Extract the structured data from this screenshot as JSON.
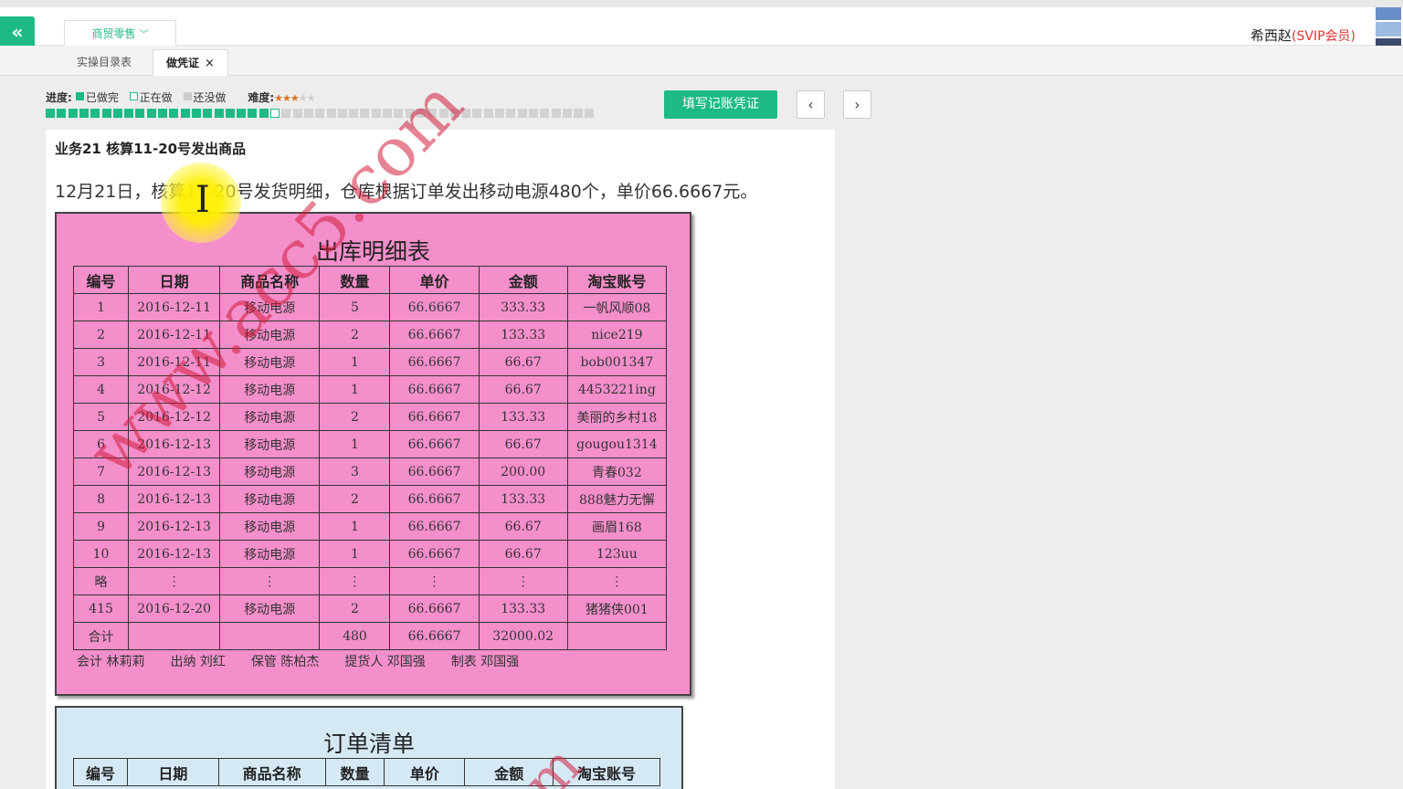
{
  "top": {
    "back_icon": "«",
    "module": "商贸零售",
    "user": "希西赵",
    "vip": "(SVIP会员)"
  },
  "tabs": [
    {
      "label": "实操目录表"
    },
    {
      "label": "做凭证",
      "close": "×"
    }
  ],
  "legend": {
    "progress_label": "进度:",
    "done": "已做完",
    "doing": "正在做",
    "todo": "还没做",
    "difficulty_label": "难度:",
    "difficulty_stars": 3,
    "difficulty_max": 5
  },
  "progress": {
    "total": 49,
    "done": 20,
    "current": 21
  },
  "buttons": {
    "fill": "填写记账凭证",
    "prev": "‹",
    "next": "›"
  },
  "task": {
    "title": "业务21 核算11-20号发出商品",
    "description": "12月21日，核算11-20号发货明细，仓库根据订单发出移动电源480个，单价66.6667元。"
  },
  "doc1": {
    "title": "出库明细表",
    "headers": [
      "编号",
      "日期",
      "商品名称",
      "数量",
      "单价",
      "金额",
      "淘宝账号"
    ],
    "rows": [
      [
        "1",
        "2016-12-11",
        "移动电源",
        "5",
        "66.6667",
        "333.33",
        "一帆风顺08"
      ],
      [
        "2",
        "2016-12-11",
        "移动电源",
        "2",
        "66.6667",
        "133.33",
        "nice219"
      ],
      [
        "3",
        "2016-12-11",
        "移动电源",
        "1",
        "66.6667",
        "66.67",
        "bob001347"
      ],
      [
        "4",
        "2016-12-12",
        "移动电源",
        "1",
        "66.6667",
        "66.67",
        "4453221ing"
      ],
      [
        "5",
        "2016-12-12",
        "移动电源",
        "2",
        "66.6667",
        "133.33",
        "美丽的乡村18"
      ],
      [
        "6",
        "2016-12-13",
        "移动电源",
        "1",
        "66.6667",
        "66.67",
        "gougou1314"
      ],
      [
        "7",
        "2016-12-13",
        "移动电源",
        "3",
        "66.6667",
        "200.00",
        "青春032"
      ],
      [
        "8",
        "2016-12-13",
        "移动电源",
        "2",
        "66.6667",
        "133.33",
        "888魅力无懈"
      ],
      [
        "9",
        "2016-12-13",
        "移动电源",
        "1",
        "66.6667",
        "66.67",
        "画眉168"
      ],
      [
        "10",
        "2016-12-13",
        "移动电源",
        "1",
        "66.6667",
        "66.67",
        "123uu"
      ],
      [
        "略",
        "⋮",
        "⋮",
        "⋮",
        "⋮",
        "⋮",
        "⋮"
      ],
      [
        "415",
        "2016-12-20",
        "移动电源",
        "2",
        "66.6667",
        "133.33",
        "猪猪侠001"
      ],
      [
        "合计",
        "",
        "",
        "480",
        "66.6667",
        "32000.02",
        ""
      ]
    ],
    "footer": [
      "会计  林莉莉",
      "出纳  刘红",
      "保管  陈柏杰",
      "提货人  邓国强",
      "制表  邓国强"
    ]
  },
  "doc2": {
    "title": "订单清单",
    "headers": [
      "编号",
      "日期",
      "商品名称",
      "数量",
      "单价",
      "金额",
      "淘宝账号"
    ]
  },
  "watermark": "www.acc5.com",
  "watermark2": "m"
}
